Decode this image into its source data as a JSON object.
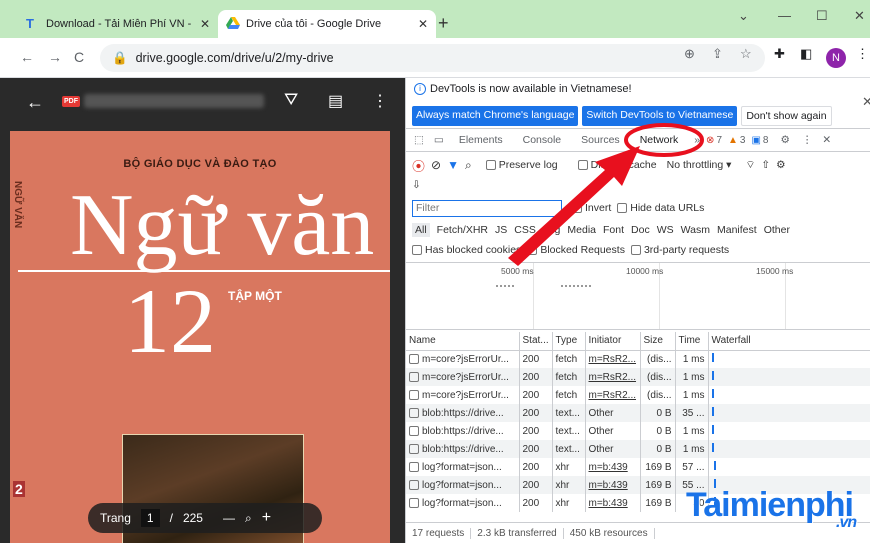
{
  "browser": {
    "tabs": [
      {
        "title": "Download - Tải Miễn Phí VN - Ph",
        "close": "✕"
      },
      {
        "title": "Drive của tôi - Google Drive",
        "close": "✕"
      }
    ],
    "new_tab": "+",
    "window": {
      "minimize": "—",
      "maximize": "☐",
      "close": "✕",
      "chevron": "⌄"
    },
    "url": "drive.google.com/drive/u/2/my-drive",
    "avatar_letter": "N"
  },
  "viewer": {
    "file_badge": "PDF",
    "book": {
      "publisher": "BỘ GIÁO DỤC VÀ ĐÀO TẠO",
      "title": "Ngữ văn",
      "number": "12",
      "volume": "TẬP MỘT",
      "spine_letters": "NGỮ VĂN",
      "spine_number": "2"
    },
    "pager": {
      "label": "Trang",
      "current": "1",
      "separator": "/",
      "total": "225",
      "zoom_out": "—",
      "zoom_in": "+"
    }
  },
  "devtools": {
    "banner": {
      "message": "DevTools is now available in Vietnamese!",
      "btn_match": "Always match Chrome's language",
      "btn_switch": "Switch DevTools to Vietnamese",
      "btn_dismiss": "Don't show again"
    },
    "tabs": [
      "Elements",
      "Console",
      "Sources",
      "Network"
    ],
    "counts": {
      "errors": "7",
      "warnings": "3",
      "messages": "8"
    },
    "toolbar": {
      "preserve_log": "Preserve log",
      "disable_cache": "Disable cache",
      "throttling": "No throttling"
    },
    "filter": {
      "placeholder": "Filter",
      "invert": "Invert",
      "hide_data_urls": "Hide data URLs"
    },
    "type_filters": [
      "All",
      "Fetch/XHR",
      "JS",
      "CSS",
      "Img",
      "Media",
      "Font",
      "Doc",
      "WS",
      "Wasm",
      "Manifest",
      "Other"
    ],
    "checks": {
      "blocked_cookies": "Has blocked cookies",
      "blocked_requests": "Blocked Requests",
      "third_party": "3rd-party requests"
    },
    "timeline_ticks": [
      "5000 ms",
      "10000 ms",
      "15000 ms"
    ],
    "columns": [
      "Name",
      "Stat...",
      "Type",
      "Initiator",
      "Size",
      "Time",
      "Waterfall"
    ],
    "rows": [
      {
        "name": "m=core?jsErrorUr...",
        "status": "200",
        "type": "fetch",
        "initiator": "m=RsR2...",
        "size": "(dis...",
        "time": "1 ms"
      },
      {
        "name": "m=core?jsErrorUr...",
        "status": "200",
        "type": "fetch",
        "initiator": "m=RsR2...",
        "size": "(dis...",
        "time": "1 ms"
      },
      {
        "name": "m=core?jsErrorUr...",
        "status": "200",
        "type": "fetch",
        "initiator": "m=RsR2...",
        "size": "(dis...",
        "time": "1 ms"
      },
      {
        "name": "blob:https://drive...",
        "status": "200",
        "type": "text...",
        "initiator": "Other",
        "size": "0 B",
        "time": "35 ..."
      },
      {
        "name": "blob:https://drive...",
        "status": "200",
        "type": "text...",
        "initiator": "Other",
        "size": "0 B",
        "time": "1 ms"
      },
      {
        "name": "blob:https://drive...",
        "status": "200",
        "type": "text...",
        "initiator": "Other",
        "size": "0 B",
        "time": "1 ms"
      },
      {
        "name": "log?format=json...",
        "status": "200",
        "type": "xhr",
        "initiator": "m=b:439",
        "size": "169 B",
        "time": "57 ..."
      },
      {
        "name": "log?format=json...",
        "status": "200",
        "type": "xhr",
        "initiator": "m=b:439",
        "size": "169 B",
        "time": "55 ..."
      },
      {
        "name": "log?format=json...",
        "status": "200",
        "type": "xhr",
        "initiator": "m=b:439",
        "size": "169 B",
        "time": "50"
      }
    ],
    "status_bar": {
      "requests": "17 requests",
      "transferred": "2.3 kB transferred",
      "resources": "450 kB resources"
    }
  },
  "watermark": {
    "main": "Taimienphi",
    "suffix": ".vn"
  },
  "colors": {
    "tab_strip": "#c2e9c0",
    "accent": "#1a73e8",
    "annotation": "#e8101e",
    "cover": "#d9775f"
  }
}
